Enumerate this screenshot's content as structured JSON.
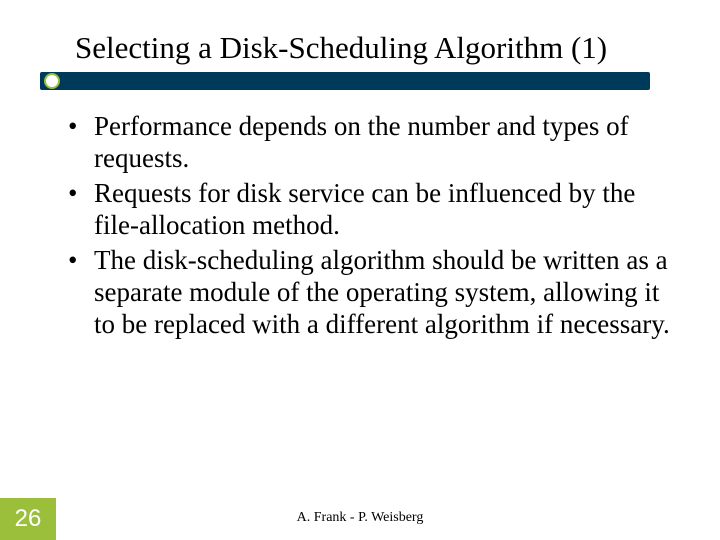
{
  "title": "Selecting a Disk-Scheduling Algorithm (1)",
  "bullets": [
    "Performance depends on the number and types of requests.",
    "Requests for disk service can be influenced by the file-allocation method.",
    "The disk-scheduling algorithm should be written as a separate module of the operating system, allowing it to be replaced with a different algorithm if necessary."
  ],
  "page_number": "26",
  "footer": "A. Frank - P. Weisberg",
  "colors": {
    "accent_bar": "#003a5a",
    "accent_green": "#9bbf3b"
  }
}
